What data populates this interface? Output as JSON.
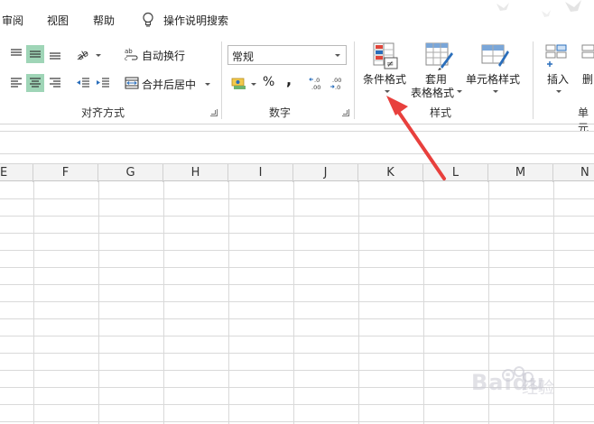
{
  "menu": {
    "items": [
      "审阅",
      "视图",
      "帮助"
    ],
    "tell_me": "操作说明搜索"
  },
  "ribbon": {
    "alignment": {
      "label": "对齐方式",
      "wrap_text": "自动换行",
      "merge_center": "合并后居中"
    },
    "number": {
      "label": "数字",
      "format_value": "常规",
      "percent": "%",
      "comma": ",",
      "inc_decimal": "←.0 .00",
      "dec_decimal": ".00 →.0"
    },
    "styles": {
      "label": "样式",
      "conditional_formatting": "条件格式",
      "format_as_table_line1": "套用",
      "format_as_table_line2": "表格格式",
      "cell_styles": "单元格样式"
    },
    "cells": {
      "label": "单元",
      "insert": "插入",
      "delete": "删"
    }
  },
  "columns": [
    "E",
    "F",
    "G",
    "H",
    "I",
    "J",
    "K",
    "L",
    "M",
    "N"
  ],
  "watermark": {
    "brand": "Baidu",
    "suffix": "经验"
  },
  "colors": {
    "selected": "#9fd5b7",
    "arrow": "#e8403d"
  }
}
